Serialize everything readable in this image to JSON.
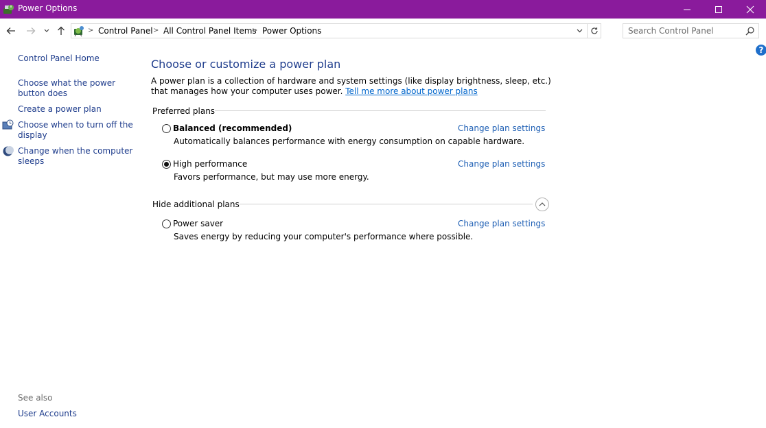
{
  "window": {
    "title": "Power Options",
    "app_icon": "power-options-icon"
  },
  "address_bar": {
    "location_icon": "control-panel-icon",
    "breadcrumbs": [
      "Control Panel",
      "All Control Panel Items",
      "Power Options"
    ]
  },
  "search": {
    "placeholder": "Search Control Panel"
  },
  "sidebar": {
    "home": "Control Panel Home",
    "items": [
      {
        "label": "Choose what the power button does",
        "icon": ""
      },
      {
        "label": "Create a power plan",
        "icon": ""
      },
      {
        "label": "Choose when to turn off the display",
        "icon": "display-clock-icon"
      },
      {
        "label": "Change when the computer sleeps",
        "icon": "moon-icon"
      }
    ],
    "see_also": "See also",
    "see_also_links": [
      "User Accounts"
    ]
  },
  "main": {
    "heading": "Choose or customize a power plan",
    "description": "A power plan is a collection of hardware and system settings (like display brightness, sleep, etc.) that manages how your computer uses power.",
    "learn_more": "Tell me more about power plans",
    "preferred_label": "Preferred plans",
    "additional_label": "Hide additional plans",
    "plans": [
      {
        "name": "Balanced (recommended)",
        "description": "Automatically balances performance with energy consumption on capable hardware.",
        "selected": false,
        "change": "Change plan settings"
      },
      {
        "name": "High performance",
        "description": "Favors performance, but may use more energy.",
        "selected": true,
        "change": "Change plan settings"
      },
      {
        "name": "Power saver",
        "description": "Saves energy by reducing your computer's performance where possible.",
        "selected": false,
        "change": "Change plan settings"
      }
    ]
  },
  "colors": {
    "titlebar": "#8a1b9c",
    "link": "#1e3c8c",
    "heading": "#1e3c8c"
  }
}
